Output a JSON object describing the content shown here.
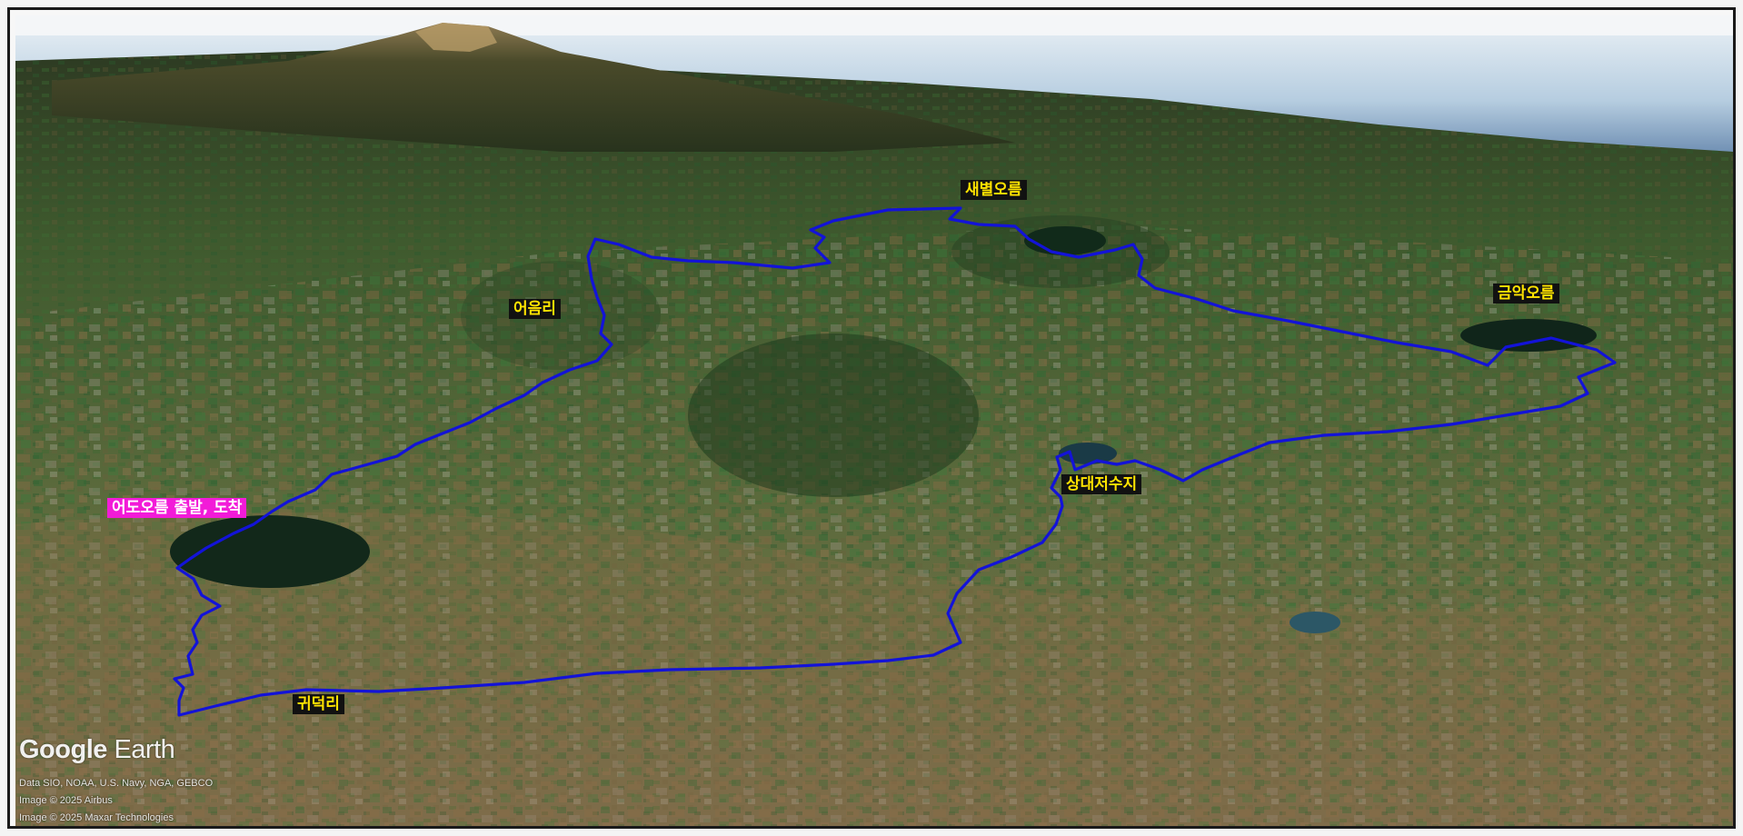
{
  "map": {
    "view": "3d-oblique-satellite",
    "colors": {
      "route": "#1313d8",
      "label_text": "#ffe300",
      "label_background": "#111111",
      "start_label_background": "#f21bd8",
      "start_label_text": "#ffffff",
      "sea": "#b9cfe0",
      "mountain": "#3c3d22",
      "farmland": "#5f6d3c"
    },
    "labels": {
      "saebyeol": "새별오름",
      "eoeumri": "어음리",
      "geumak": "금악오름",
      "sangdae": "상대저수지",
      "start": "어도오름 출발, 도착",
      "gwideok": "귀덕리"
    }
  },
  "branding": {
    "logo_brand": "Google",
    "logo_product": "Earth"
  },
  "attribution": [
    "Data SIO, NOAA, U.S. Navy, NGA, GEBCO",
    "Image © 2025 Airbus",
    "Image © 2025 Maxar Technologies"
  ]
}
